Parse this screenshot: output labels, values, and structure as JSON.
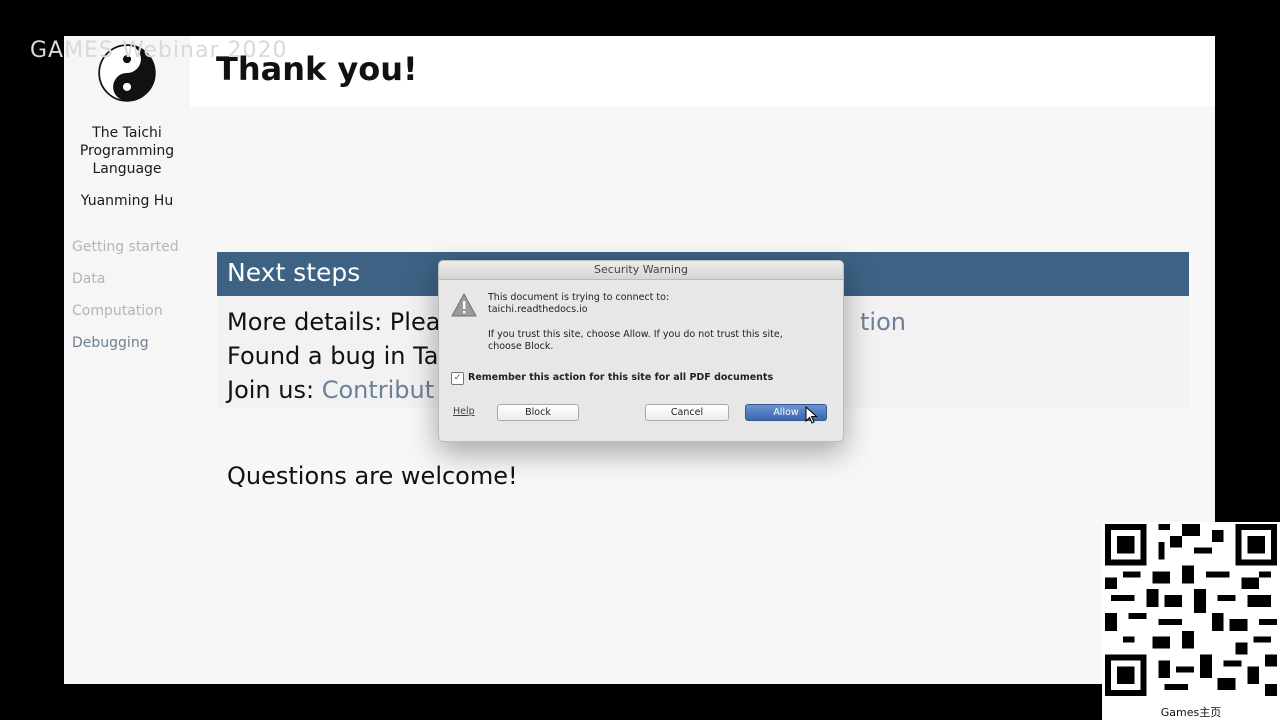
{
  "watermark": "GAMES Webinar 2020",
  "sidebar": {
    "title_lines": [
      "The Taichi",
      "Programming",
      "Language"
    ],
    "author": "Yuanming Hu",
    "nav": [
      {
        "label": "Getting started",
        "active": false
      },
      {
        "label": "Data",
        "active": false
      },
      {
        "label": "Computation",
        "active": false
      },
      {
        "label": "Debugging",
        "active": true
      }
    ]
  },
  "slide": {
    "title": "Thank you!",
    "block_title": "Next steps",
    "steps": [
      {
        "prefix": "More details: Plea",
        "link_tail": "tion"
      },
      {
        "prefix": "Found a bug in Ta",
        "link_tail": ""
      },
      {
        "prefix": "Join us: ",
        "link_tail": "Contribut"
      }
    ],
    "questions": "Questions are welcome!"
  },
  "dialog": {
    "title": "Security Warning",
    "line1": "This document is trying to connect to:",
    "line2": "taichi.readthedocs.io",
    "line3": "If you trust this site, choose Allow. If you do not trust this site,",
    "line4": "choose Block.",
    "remember_label": "Remember this action for this site for all PDF documents",
    "remember_checked": true,
    "help_label": "Help",
    "block_label": "Block",
    "cancel_label": "Cancel",
    "allow_label": "Allow"
  },
  "qr": {
    "caption": "Games主页"
  },
  "colors": {
    "accent_bar": "#3d6284",
    "link": "#6c8199",
    "allow_button": "#3a67b2"
  }
}
